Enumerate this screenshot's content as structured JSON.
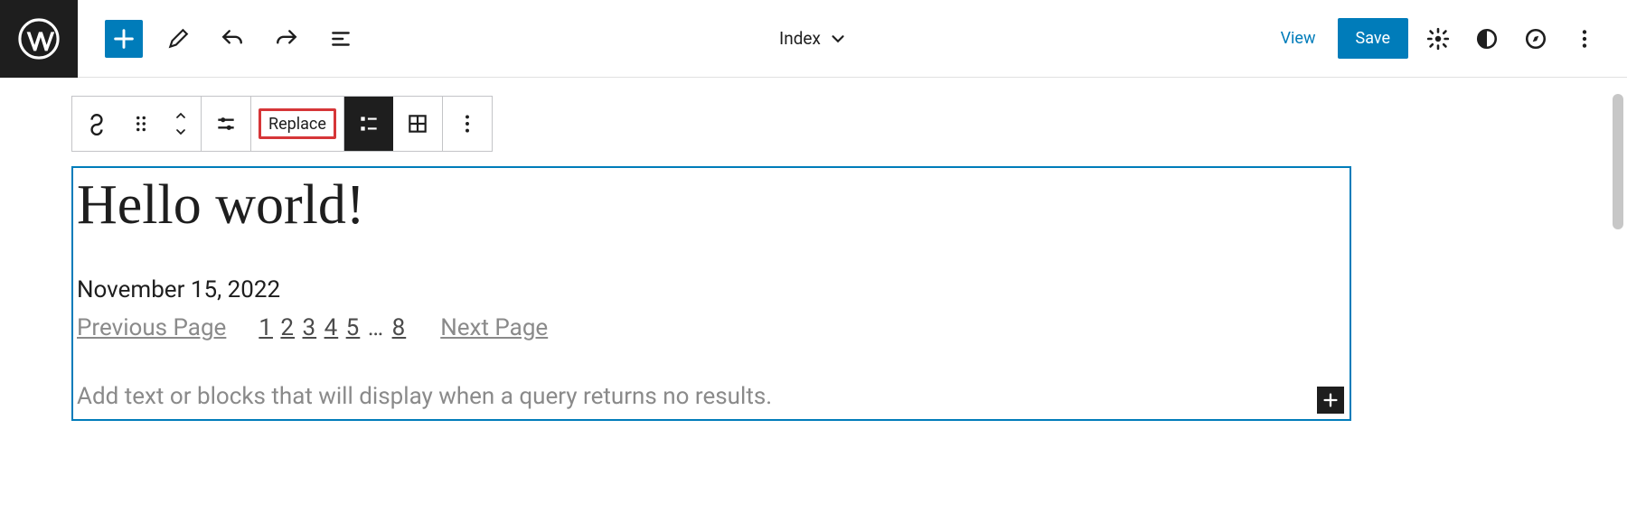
{
  "header": {
    "template_label": "Index",
    "view_label": "View",
    "save_label": "Save"
  },
  "block_toolbar": {
    "replace_label": "Replace"
  },
  "canvas": {
    "post_title": "Hello world!",
    "post_date": "November 15, 2022",
    "pagination": {
      "prev_label": "Previous Page",
      "next_label": "Next Page",
      "pages": [
        "1",
        "2",
        "3",
        "4",
        "5",
        "…",
        "8"
      ]
    },
    "no_results_placeholder": "Add text or blocks that will display when a query returns no results."
  }
}
